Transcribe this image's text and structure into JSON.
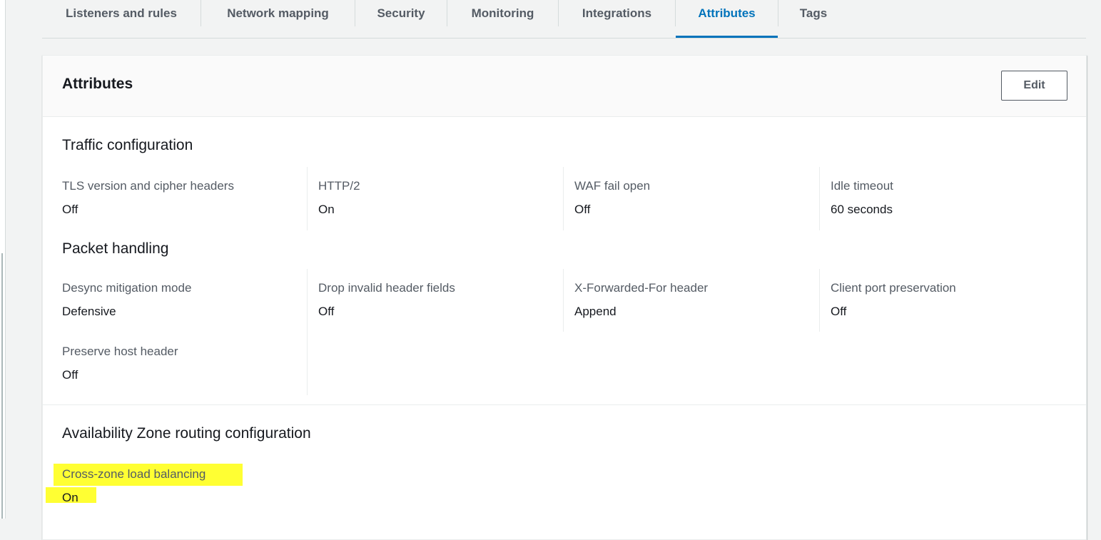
{
  "tabs": [
    {
      "label": "Listeners and rules",
      "active": false
    },
    {
      "label": "Network mapping",
      "active": false
    },
    {
      "label": "Security",
      "active": false
    },
    {
      "label": "Monitoring",
      "active": false
    },
    {
      "label": "Integrations",
      "active": false
    },
    {
      "label": "Attributes",
      "active": true
    },
    {
      "label": "Tags",
      "active": false
    }
  ],
  "card": {
    "title": "Attributes",
    "edit_label": "Edit"
  },
  "traffic": {
    "title": "Traffic configuration",
    "items": [
      {
        "label": "TLS version and cipher headers",
        "value": "Off"
      },
      {
        "label": "HTTP/2",
        "value": "On"
      },
      {
        "label": "WAF fail open",
        "value": "Off"
      },
      {
        "label": "Idle timeout",
        "value": "60 seconds"
      }
    ]
  },
  "packet": {
    "title": "Packet handling",
    "items": [
      {
        "label": "Desync mitigation mode",
        "value": "Defensive"
      },
      {
        "label": "Drop invalid header fields",
        "value": "Off"
      },
      {
        "label": "X-Forwarded-For header",
        "value": "Append"
      },
      {
        "label": "Client port preservation",
        "value": "Off"
      },
      {
        "label": "Preserve host header",
        "value": "Off"
      }
    ]
  },
  "az": {
    "title": "Availability Zone routing configuration",
    "items": [
      {
        "label": "Cross-zone load balancing",
        "value": "On"
      }
    ]
  },
  "colors": {
    "accent": "#0073bb",
    "highlight": "#ffff33",
    "label_gray": "#545b64"
  }
}
